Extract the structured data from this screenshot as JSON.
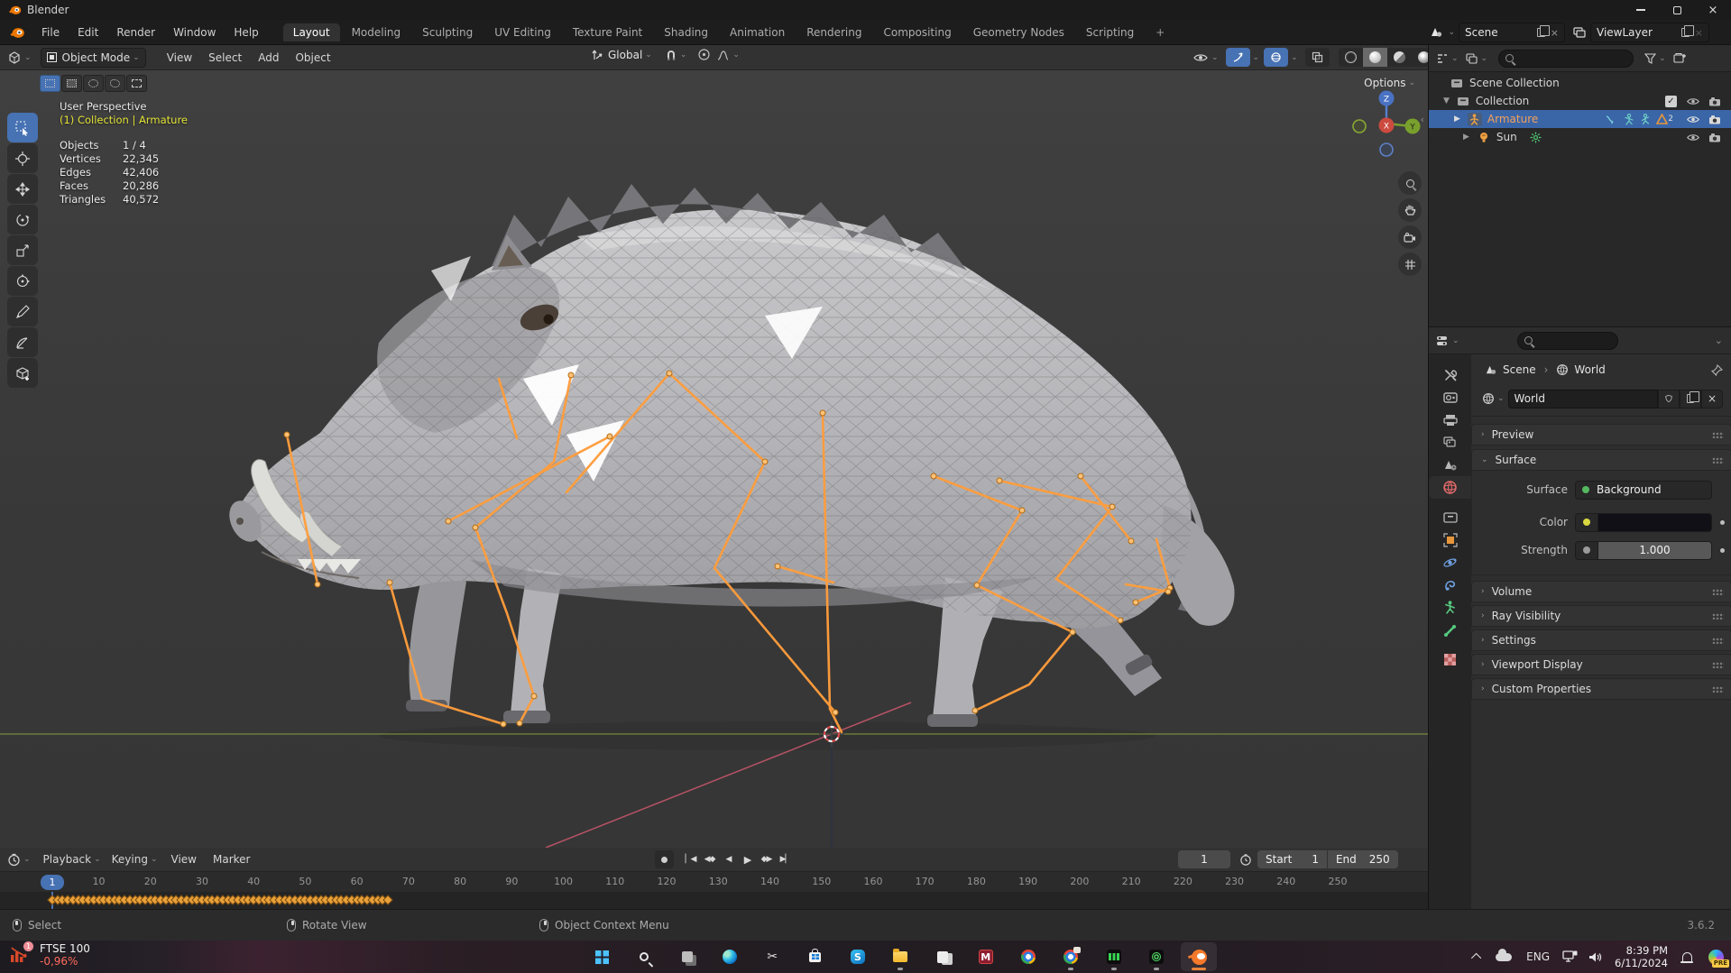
{
  "window": {
    "title": "Blender"
  },
  "topbar": {
    "menus": [
      "File",
      "Edit",
      "Render",
      "Window",
      "Help"
    ],
    "tabs": [
      "Layout",
      "Modeling",
      "Sculpting",
      "UV Editing",
      "Texture Paint",
      "Shading",
      "Animation",
      "Rendering",
      "Compositing",
      "Geometry Nodes",
      "Scripting"
    ],
    "active_tab": "Layout",
    "add_tab_label": "+",
    "scene_name": "Scene",
    "view_layer_name": "ViewLayer"
  },
  "viewport_header": {
    "mode": "Object Mode",
    "menus": [
      "View",
      "Select",
      "Add",
      "Object"
    ],
    "orientation": "Global",
    "options_label": "Options"
  },
  "viewport_overlay": {
    "perspective": "User Perspective",
    "context": "(1) Collection | Armature",
    "stats": [
      {
        "label": "Objects",
        "value": "1 / 4"
      },
      {
        "label": "Vertices",
        "value": "22,345"
      },
      {
        "label": "Edges",
        "value": "42,406"
      },
      {
        "label": "Faces",
        "value": "20,286"
      },
      {
        "label": "Triangles",
        "value": "40,572"
      }
    ],
    "gizmo_axes": {
      "x": "X",
      "y": "Y",
      "z": "Z"
    }
  },
  "outliner": {
    "rows": {
      "scene_collection": "Scene Collection",
      "collection": "Collection",
      "armature": "Armature",
      "armature_badge": "2",
      "sun": "Sun"
    }
  },
  "properties": {
    "breadcrumb": {
      "scene": "Scene",
      "world": "World"
    },
    "datablock_name": "World",
    "panels": {
      "preview": "Preview",
      "surface": "Surface",
      "volume": "Volume",
      "ray_visibility": "Ray Visibility",
      "settings": "Settings",
      "viewport_display": "Viewport Display",
      "custom_properties": "Custom Properties"
    },
    "surface_fields": {
      "surface_label": "Surface",
      "surface_value": "Background",
      "color_label": "Color",
      "strength_label": "Strength",
      "strength_value": "1.000"
    }
  },
  "timeline": {
    "menus": [
      "Playback",
      "Keying",
      "View",
      "Marker"
    ],
    "current_frame": "1",
    "ticks": [
      "1",
      "10",
      "20",
      "30",
      "40",
      "50",
      "60",
      "70",
      "80",
      "90",
      "100",
      "110",
      "120",
      "130",
      "140",
      "150",
      "160",
      "170",
      "180",
      "190",
      "200",
      "210",
      "220",
      "230",
      "240",
      "250"
    ],
    "start_label": "Start",
    "start_value": "1",
    "end_label": "End",
    "end_value": "250",
    "keyframes": {
      "first_frame": 1,
      "last_frame": 66
    }
  },
  "statusbar": {
    "hint_select": "Select",
    "hint_rotate": "Rotate View",
    "hint_context": "Object Context Menu",
    "version": "3.6.2"
  },
  "taskbar": {
    "widget": {
      "badge": "1",
      "title": "FTSE 100",
      "change": "-0,96%"
    },
    "apps": [
      {
        "kind": "start",
        "name": "start"
      },
      {
        "kind": "search",
        "name": "search"
      },
      {
        "kind": "taskview",
        "name": "task-view"
      },
      {
        "kind": "edge",
        "name": "edge"
      },
      {
        "kind": "snip",
        "name": "snipping-tool"
      },
      {
        "kind": "store",
        "name": "microsoft-store"
      },
      {
        "kind": "skype",
        "name": "skype",
        "glyph": "S"
      },
      {
        "kind": "explorer",
        "name": "file-explorer",
        "indicator": "dot"
      },
      {
        "kind": "tiles",
        "name": "notes"
      },
      {
        "kind": "mapp",
        "name": "m-app",
        "glyph": "M"
      },
      {
        "kind": "chrome",
        "name": "chrome"
      },
      {
        "kind": "chromealt",
        "name": "chrome-profile",
        "indicator": "dot"
      },
      {
        "kind": "greenapp",
        "name": "green-app",
        "indicator": "dot"
      },
      {
        "kind": "targetapp",
        "name": "target-app",
        "indicator": "dot"
      },
      {
        "kind": "blender",
        "name": "blender",
        "indicator": "active"
      }
    ],
    "tray": {
      "language": "ENG",
      "time": "8:39 PM",
      "date": "6/11/2024",
      "copilot_badge": "PRE"
    },
    "snip_glyph": "✂"
  },
  "colors": {
    "accent_blue": "#4772b3",
    "selection_blue": "#3a66a8",
    "active_object_orange": "#f5a05a",
    "bone_orange": "#ff9d3c",
    "keyframe_orange": "#e9a23b",
    "axis_green": "#7e943f",
    "axis_red": "#c4566b",
    "widget_red": "#ff6b5e"
  }
}
